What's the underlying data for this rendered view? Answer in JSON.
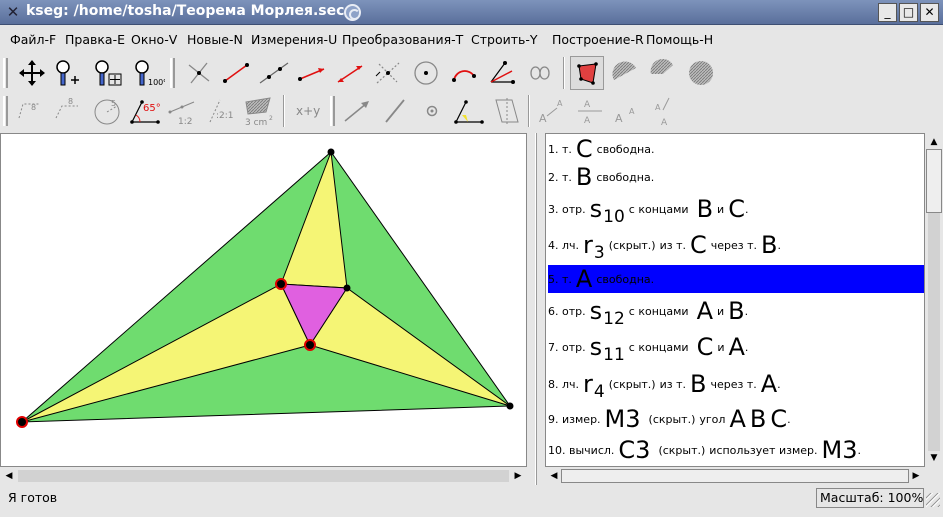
{
  "window": {
    "title": "kseg: /home/tosha/Теорема Морлея.sec"
  },
  "window_buttons": {
    "minimize": "_",
    "maximize": "□",
    "close": "✕"
  },
  "menu": [
    "Файл-F",
    "Правка-E",
    "Окно-V",
    "Новые-N",
    "Измерения-U",
    "Преобразования-T",
    "Строить-Y",
    "Построение-R",
    "Помощь-H"
  ],
  "toolbar2_labels": {
    "angle_value": "65°",
    "ratio_1": "1:2",
    "ratio_2": ":2:1",
    "area": "3 cm",
    "area_exp": "2",
    "calc": "x+y"
  },
  "objects": [
    {
      "num": "1.",
      "kind": "т.",
      "name": "C",
      "desc": "свободна."
    },
    {
      "num": "2.",
      "kind": "т.",
      "name": "B",
      "desc": "свободна."
    },
    {
      "num": "3.",
      "kind": "отр.",
      "name": "s",
      "sub": "10",
      "desc": "с концами",
      "p1": "B",
      "conj": "и",
      "p2": "C",
      "end": "."
    },
    {
      "num": "4.",
      "kind": "лч.",
      "name": "r",
      "sub": "3",
      "hidden": "(скрыт.)",
      "desc": "из т.",
      "p1": "C",
      "conj": "через т.",
      "p2": "B",
      "end": "."
    },
    {
      "num": "5.",
      "kind": "т.",
      "name": "A",
      "desc": "свободна.",
      "selected": true
    },
    {
      "num": "6.",
      "kind": "отр.",
      "name": "s",
      "sub": "12",
      "desc": "с концами",
      "p1": "A",
      "conj": "и",
      "p2": "B",
      "end": "."
    },
    {
      "num": "7.",
      "kind": "отр.",
      "name": "s",
      "sub": "11",
      "desc": "с концами",
      "p1": "C",
      "conj": "и",
      "p2": "A",
      "end": "."
    },
    {
      "num": "8.",
      "kind": "лч.",
      "name": "r",
      "sub": "4",
      "hidden": "(скрыт.)",
      "desc": "из т.",
      "p1": "B",
      "conj": "через т.",
      "p2": "A",
      "end": "."
    },
    {
      "num": "9.",
      "kind": "измер.",
      "name": "M3",
      "hidden": "(скрыт.)",
      "desc": "угол",
      "p1": "A",
      "conj": "B",
      "p2": "C",
      "end": "."
    },
    {
      "num": "10.",
      "kind": "вычисл.",
      "name": "C3",
      "hidden": "(скрыт.)",
      "desc": "использует измер.",
      "p1": "M3",
      "end": "."
    }
  ],
  "status": {
    "text": "Я готов",
    "zoom": "Масштаб: 100%"
  },
  "colors": {
    "outer_fill": "#6fdc6f",
    "middle_fill": "#f5f575",
    "inner_fill": "#e060e0",
    "selection": "#0000ff",
    "title_bar": "#6b80aa"
  },
  "icons": [
    "move-icon",
    "zoom-plus-icon",
    "zoom-fit-icon",
    "zoom-100-icon",
    "intersection-icon",
    "segment-icon",
    "line-icon",
    "ray-icon",
    "perpendicular-icon",
    "midpoint-icon",
    "circle-icon",
    "arc-icon",
    "angle-bisector-icon",
    "locus-icon",
    "polygon-fill-icon",
    "circle-interior-icon",
    "arc-sector-icon",
    "arc-segment-icon"
  ]
}
